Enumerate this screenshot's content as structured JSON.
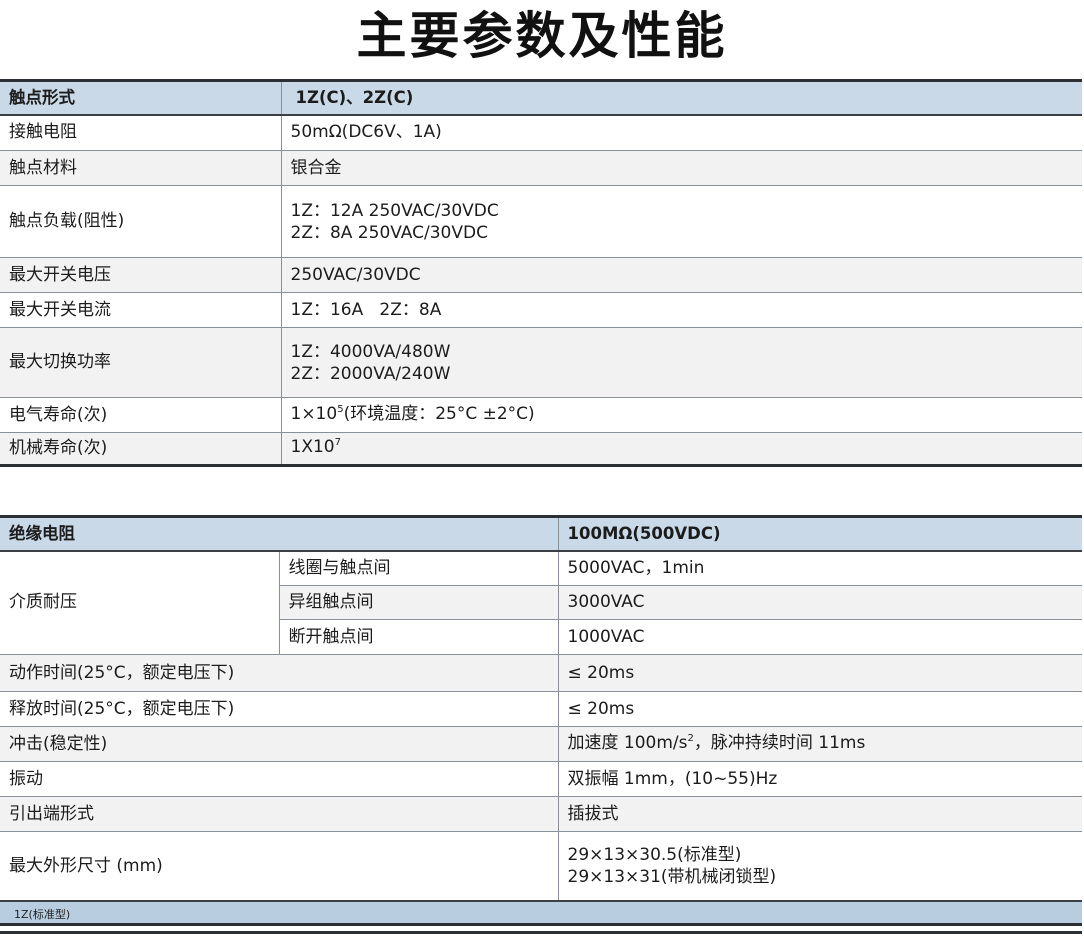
{
  "title": "主要参数及性能",
  "table1": {
    "header": {
      "label": "触点形式",
      "value": "1Z(C)、2Z(C)"
    },
    "rows": [
      {
        "label": "接触电阻",
        "value": "50mΩ(DC6V、1A)"
      },
      {
        "label": "触点材料",
        "value": "银合金"
      },
      {
        "label": "触点负载(阻性)",
        "line1": "1Z：12A 250VAC/30VDC",
        "line2": "2Z：8A 250VAC/30VDC"
      },
      {
        "label": "最大开关电压",
        "value": "250VAC/30VDC"
      },
      {
        "label": "最大开关电流",
        "value": "1Z：16A   2Z：8A"
      },
      {
        "label": "最大切换功率",
        "line1": "1Z：4000VA/480W",
        "line2": "2Z：2000VA/240W"
      },
      {
        "label": "电气寿命(次)",
        "value_pre": "1×10",
        "value_sup": "5",
        "value_post": "(环境温度：25°C ±2°C)"
      },
      {
        "label": "机械寿命(次)",
        "value_pre": "1X10",
        "value_sup": "7"
      }
    ]
  },
  "table2": {
    "header": {
      "label": "绝缘电阻",
      "value": "100MΩ(500VDC)"
    },
    "dielectric": {
      "label": "介质耐压",
      "items": [
        {
          "sub": "线圈与触点间",
          "value": "5000VAC，1min"
        },
        {
          "sub": "异组触点间",
          "value": "3000VAC"
        },
        {
          "sub": "断开触点间",
          "value": "1000VAC"
        }
      ]
    },
    "rows": [
      {
        "label": "动作时间(25°C，额定电压下)",
        "value": "≤ 20ms"
      },
      {
        "label": "释放时间(25°C，额定电压下)",
        "value": "≤ 20ms"
      },
      {
        "label": "冲击(稳定性)",
        "value_pre": "加速度 100m/s",
        "value_sup": "2",
        "value_post": "，脉冲持续时间 11ms"
      },
      {
        "label": "振动",
        "value": "双振幅 1mm，(10~55)Hz"
      },
      {
        "label": "引出端形式",
        "value": "插拔式"
      },
      {
        "label": "最大外形尺寸 (mm)",
        "line1": "29×13×30.5(标准型)",
        "line2": "29×13×31(带机械闭锁型)"
      }
    ]
  },
  "footer_label": "1Z(标准型)"
}
